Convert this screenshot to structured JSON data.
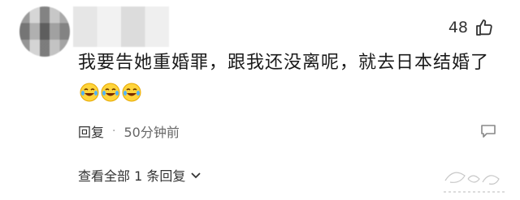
{
  "comment": {
    "like_count": "48",
    "text": "我要告她重婚罪，跟我还没离呢，就去日本结婚了",
    "emojis": [
      "laugh-cry-emoji",
      "laugh-cry-emoji",
      "laugh-cry-emoji"
    ],
    "reply_label": "回复",
    "separator": "·",
    "timestamp": "50分钟前",
    "view_replies_label": "查看全部 1 条回复"
  },
  "icons": {
    "like": "thumbs-up-icon",
    "reply": "reply-icon",
    "expand": "chevron-down-icon"
  },
  "colors": {
    "text": "#1a1a1a",
    "meta": "#333333",
    "timestamp": "#666666",
    "emoji_face": "#ffd43b"
  }
}
